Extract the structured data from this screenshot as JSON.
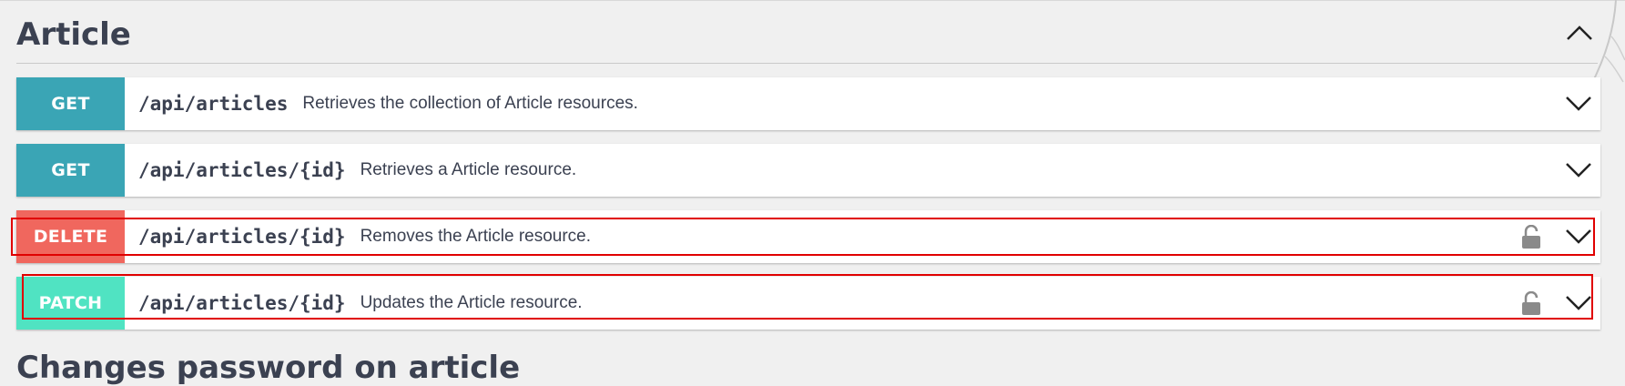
{
  "section": {
    "title": "Article",
    "toggle_icon": "chevron-up-icon"
  },
  "operations": [
    {
      "method": "GET",
      "color": "#3aa5b5",
      "path": "/api/articles",
      "description": "Retrieves the collection of Article resources.",
      "locked": false
    },
    {
      "method": "GET",
      "color": "#3aa5b5",
      "path": "/api/articles/{id}",
      "description": "Retrieves a Article resource.",
      "locked": false
    },
    {
      "method": "DELETE",
      "color": "#f0675e",
      "path": "/api/articles/{id}",
      "description": "Removes the Article resource.",
      "locked": true
    },
    {
      "method": "PATCH",
      "color": "#50e3c2",
      "path": "/api/articles/{id}",
      "description": "Updates the Article resource.",
      "locked": true
    }
  ],
  "icons": {
    "expand": "chevron-down-icon",
    "lock": "lock-icon"
  },
  "highlight_color": "#e00000",
  "next_section": {
    "title": "Changes password on article"
  }
}
